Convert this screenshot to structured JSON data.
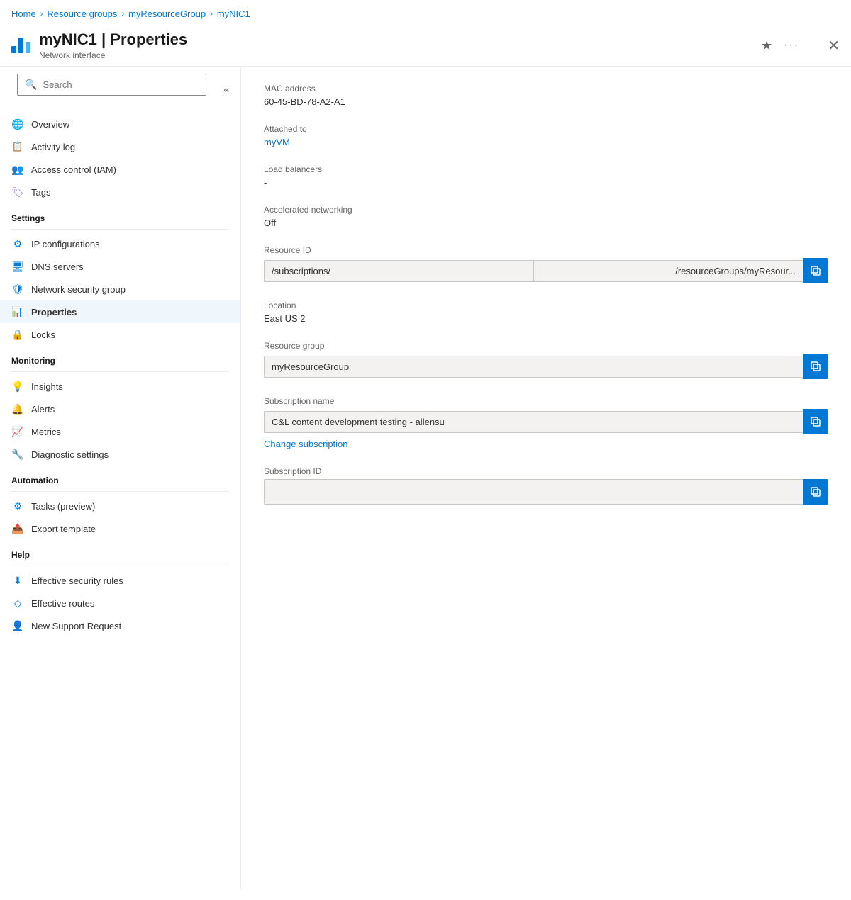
{
  "breadcrumb": {
    "items": [
      "Home",
      "Resource groups",
      "myResourceGroup",
      "myNIC1"
    ]
  },
  "header": {
    "title": "myNIC1 | Properties",
    "subtitle": "Network interface",
    "star_label": "★",
    "more_label": "···",
    "close_label": "✕"
  },
  "sidebar": {
    "search_placeholder": "Search",
    "collapse_label": "«",
    "sections": [
      {
        "items": [
          {
            "id": "overview",
            "label": "Overview",
            "icon": "🌐",
            "icon_class": "icon-green",
            "active": false
          },
          {
            "id": "activity-log",
            "label": "Activity log",
            "icon": "📋",
            "icon_class": "icon-blue",
            "active": false
          },
          {
            "id": "access-control",
            "label": "Access control (IAM)",
            "icon": "👥",
            "icon_class": "icon-blue",
            "active": false
          },
          {
            "id": "tags",
            "label": "Tags",
            "icon": "🏷",
            "icon_class": "icon-purple",
            "active": false
          }
        ]
      },
      {
        "header": "Settings",
        "items": [
          {
            "id": "ip-configurations",
            "label": "IP configurations",
            "icon": "⚙",
            "icon_class": "icon-blue",
            "active": false
          },
          {
            "id": "dns-servers",
            "label": "DNS servers",
            "icon": "🖥",
            "icon_class": "icon-blue",
            "active": false
          },
          {
            "id": "network-security-group",
            "label": "Network security group",
            "icon": "🛡",
            "icon_class": "icon-blue",
            "active": false
          },
          {
            "id": "properties",
            "label": "Properties",
            "icon": "📊",
            "icon_class": "icon-blue",
            "active": true
          },
          {
            "id": "locks",
            "label": "Locks",
            "icon": "🔒",
            "icon_class": "icon-gray",
            "active": false
          }
        ]
      },
      {
        "header": "Monitoring",
        "items": [
          {
            "id": "insights",
            "label": "Insights",
            "icon": "💡",
            "icon_class": "icon-purple",
            "active": false
          },
          {
            "id": "alerts",
            "label": "Alerts",
            "icon": "🔔",
            "icon_class": "icon-yellow",
            "active": false
          },
          {
            "id": "metrics",
            "label": "Metrics",
            "icon": "📈",
            "icon_class": "icon-blue",
            "active": false
          },
          {
            "id": "diagnostic-settings",
            "label": "Diagnostic settings",
            "icon": "🔧",
            "icon_class": "icon-green",
            "active": false
          }
        ]
      },
      {
        "header": "Automation",
        "items": [
          {
            "id": "tasks-preview",
            "label": "Tasks (preview)",
            "icon": "⚙",
            "icon_class": "icon-blue",
            "active": false
          },
          {
            "id": "export-template",
            "label": "Export template",
            "icon": "📤",
            "icon_class": "icon-blue",
            "active": false
          }
        ]
      },
      {
        "header": "Help",
        "items": [
          {
            "id": "effective-security-rules",
            "label": "Effective security rules",
            "icon": "⬇",
            "icon_class": "icon-blue",
            "active": false
          },
          {
            "id": "effective-routes",
            "label": "Effective routes",
            "icon": "◇",
            "icon_class": "icon-blue",
            "active": false
          },
          {
            "id": "new-support-request",
            "label": "New Support Request",
            "icon": "👤",
            "icon_class": "icon-blue",
            "active": false
          }
        ]
      }
    ]
  },
  "content": {
    "mac_address_label": "MAC address",
    "mac_address_value": "60-45-BD-78-A2-A1",
    "attached_to_label": "Attached to",
    "attached_to_value": "myVM",
    "load_balancers_label": "Load balancers",
    "load_balancers_value": "-",
    "accelerated_networking_label": "Accelerated networking",
    "accelerated_networking_value": "Off",
    "resource_id_label": "Resource ID",
    "resource_id_left": "/subscriptions/",
    "resource_id_right": "/resourceGroups/myResour...",
    "location_label": "Location",
    "location_value": "East US 2",
    "resource_group_label": "Resource group",
    "resource_group_value": "myResourceGroup",
    "subscription_name_label": "Subscription name",
    "subscription_name_value": "C&L content development testing - allensu",
    "change_subscription_label": "Change subscription",
    "subscription_id_label": "Subscription ID",
    "subscription_id_value": ""
  }
}
